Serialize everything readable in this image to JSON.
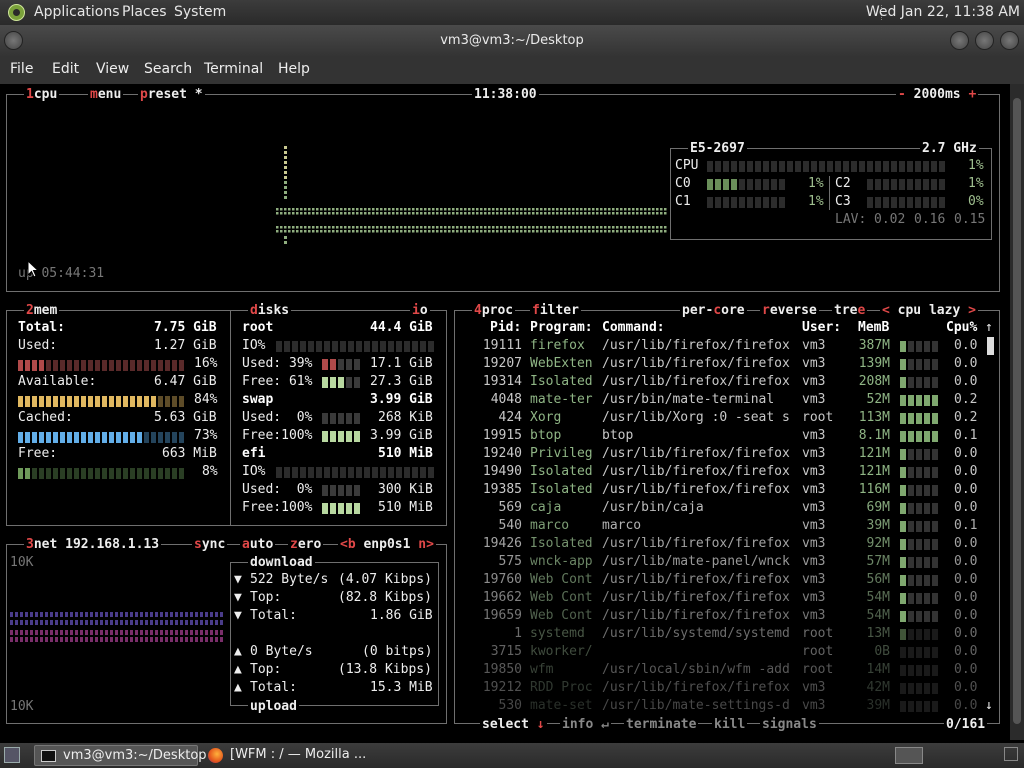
{
  "panel": {
    "menus": [
      "Applications",
      "Places",
      "System"
    ],
    "clock": "Wed Jan 22, 11:38 AM"
  },
  "window": {
    "title": "vm3@vm3:~/Desktop",
    "menus": [
      "File",
      "Edit",
      "View",
      "Search",
      "Terminal",
      "Help"
    ]
  },
  "cpu": {
    "tabs": {
      "n": "1",
      "cpu": "cpu",
      "menu": "menu",
      "preset": "preset",
      "star": "*"
    },
    "time": "11:38:00",
    "interval": "2000ms",
    "minus": "-",
    "plus": "+",
    "model": "E5-2697",
    "freq": "2.7 GHz",
    "total_label": "CPU",
    "total_pct": "1%",
    "cores": [
      {
        "label": "C0",
        "pct": "1%",
        "level": 0.01
      },
      {
        "label": "C2",
        "pct": "1%",
        "level": 0.01
      },
      {
        "label": "C1",
        "pct": "1%",
        "level": 0.01
      },
      {
        "label": "C3",
        "pct": "0%",
        "level": 0.0
      }
    ],
    "lav_label": "LAV:",
    "lav": [
      "0.02",
      "0.16",
      "0.15"
    ],
    "uptime": "up 05:44:31"
  },
  "mem": {
    "header": {
      "n": "2",
      "title": "mem"
    },
    "total_label": "Total:",
    "total": "7.75 GiB",
    "used_label": "Used:",
    "used": "1.27 GiB",
    "used_pct": "16%",
    "used_level": 0.16,
    "avail_label": "Available:",
    "avail": "6.47 GiB",
    "avail_pct": "84%",
    "avail_level": 0.84,
    "cached_label": "Cached:",
    "cached": "5.63 GiB",
    "cached_pct": "73%",
    "cached_level": 0.73,
    "free_label": "Free:",
    "free": "663 MiB",
    "free_pct": "8%",
    "free_level": 0.08
  },
  "disks": {
    "header": {
      "d": "d",
      "rest": "isks",
      "io_i": "i",
      "io_rest": "o"
    },
    "entries": [
      {
        "name": "root",
        "size": "44.4 GiB",
        "io": "IO%",
        "used_label": "Used: 39%",
        "used": "17.1 GiB",
        "free_label": "Free: 61%",
        "free": "27.3 GiB",
        "used_level": 0.39,
        "free_level": 0.61
      },
      {
        "name": "swap",
        "size": "3.99 GiB",
        "io": "",
        "used_label": "Used:  0%",
        "used": "268 KiB",
        "free_label": "Free:100%",
        "free": "3.99 GiB",
        "used_level": 0.0,
        "free_level": 1.0
      },
      {
        "name": "efi",
        "size": "510 MiB",
        "io": "IO%",
        "used_label": "Used:  0%",
        "used": "300 KiB",
        "free_label": "Free:100%",
        "free": "510 MiB",
        "used_level": 0.0,
        "free_level": 1.0
      }
    ]
  },
  "net": {
    "header": {
      "n": "3",
      "title": "net",
      "ip": "192.168.1.13",
      "sync": "sync",
      "auto_a": "a",
      "auto_rest": "uto",
      "zero_z": "z",
      "zero_rest": "ero",
      "lt": "<",
      "b": "b",
      "iface": "enp0s1",
      "gt": "n>"
    },
    "scale_top": "10K",
    "scale_bottom": "10K",
    "download_label": "download",
    "down_rate": "522 Byte/s",
    "down_rate_bits": "(4.07 Kibps)",
    "down_top_label": "Top:",
    "down_top": "(82.8 Kibps)",
    "down_total_label": "Total:",
    "down_total": "1.86 GiB",
    "up_rate": "0 Byte/s",
    "up_rate_bits": "(0 bitps)",
    "up_top_label": "Top:",
    "up_top": "(13.8 Kibps)",
    "up_total_label": "Total:",
    "up_total": "15.3 MiB",
    "upload_label": "upload"
  },
  "proc": {
    "header": {
      "n": "4",
      "title": "proc",
      "filter_f": "f",
      "filter_rest": "ilter",
      "percore_a": "per-",
      "percore_c": "c",
      "percore_b": "ore",
      "reverse_r": "r",
      "reverse_rest": "everse",
      "tree_a": "tre",
      "tree_e": "e",
      "lt": "<",
      "sort": "cpu lazy",
      "gt": ">"
    },
    "columns": {
      "pid": "Pid:",
      "program": "Program:",
      "command": "Command:",
      "user": "User:",
      "mem": "MemB",
      "cpu": "Cpu%"
    },
    "rows": [
      {
        "pid": "19111",
        "program": "firefox",
        "command": "/usr/lib/firefox/firefox",
        "user": "vm3",
        "mem": "387M",
        "cpu": "0.0",
        "spark": 0.2
      },
      {
        "pid": "19207",
        "program": "WebExten",
        "command": "/usr/lib/firefox/firefox",
        "user": "vm3",
        "mem": "139M",
        "cpu": "0.0",
        "spark": 0.15
      },
      {
        "pid": "19314",
        "program": "Isolated",
        "command": "/usr/lib/firefox/firefox",
        "user": "vm3",
        "mem": "208M",
        "cpu": "0.0",
        "spark": 0.15
      },
      {
        "pid": "4048",
        "program": "mate-ter",
        "command": "/usr/bin/mate-terminal",
        "user": "vm3",
        "mem": "52M",
        "cpu": "0.2",
        "spark": 0.9
      },
      {
        "pid": "424",
        "program": "Xorg",
        "command": "/usr/lib/Xorg :0 -seat s",
        "user": "root",
        "mem": "113M",
        "cpu": "0.2",
        "spark": 0.9
      },
      {
        "pid": "19915",
        "program": "btop",
        "command": "btop",
        "user": "vm3",
        "mem": "8.1M",
        "cpu": "0.1",
        "spark": 0.9
      },
      {
        "pid": "19240",
        "program": "Privileg",
        "command": "/usr/lib/firefox/firefox",
        "user": "vm3",
        "mem": "121M",
        "cpu": "0.0",
        "spark": 0.15
      },
      {
        "pid": "19490",
        "program": "Isolated",
        "command": "/usr/lib/firefox/firefox",
        "user": "vm3",
        "mem": "121M",
        "cpu": "0.0",
        "spark": 0.1
      },
      {
        "pid": "19385",
        "program": "Isolated",
        "command": "/usr/lib/firefox/firefox",
        "user": "vm3",
        "mem": "116M",
        "cpu": "0.0",
        "spark": 0.1
      },
      {
        "pid": "569",
        "program": "caja",
        "command": "/usr/bin/caja",
        "user": "vm3",
        "mem": "69M",
        "cpu": "0.0",
        "spark": 0.1
      },
      {
        "pid": "540",
        "program": "marco",
        "command": "marco",
        "user": "vm3",
        "mem": "39M",
        "cpu": "0.1",
        "spark": 0.1
      },
      {
        "pid": "19426",
        "program": "Isolated",
        "command": "/usr/lib/firefox/firefox",
        "user": "vm3",
        "mem": "92M",
        "cpu": "0.0",
        "spark": 0.1
      },
      {
        "pid": "575",
        "program": "wnck-app",
        "command": "/usr/lib/mate-panel/wnck",
        "user": "vm3",
        "mem": "57M",
        "cpu": "0.0",
        "spark": 0.1
      },
      {
        "pid": "19760",
        "program": "Web Cont",
        "command": "/usr/lib/firefox/firefox",
        "user": "vm3",
        "mem": "56M",
        "cpu": "0.0",
        "spark": 0.1
      },
      {
        "pid": "19662",
        "program": "Web Cont",
        "command": "/usr/lib/firefox/firefox",
        "user": "vm3",
        "mem": "54M",
        "cpu": "0.0",
        "spark": 0.1
      },
      {
        "pid": "19659",
        "program": "Web Cont",
        "command": "/usr/lib/firefox/firefox",
        "user": "vm3",
        "mem": "54M",
        "cpu": "0.0",
        "spark": 0.1
      },
      {
        "pid": "1",
        "program": "systemd",
        "command": "/usr/lib/systemd/systemd",
        "user": "root",
        "mem": "13M",
        "cpu": "0.0",
        "spark": 0.05
      },
      {
        "pid": "3715",
        "program": "kworker/",
        "command": "",
        "user": "root",
        "mem": "0B",
        "cpu": "0.0",
        "spark": 0.0
      },
      {
        "pid": "19850",
        "program": "wfm",
        "command": "/usr/local/sbin/wfm -add",
        "user": "root",
        "mem": "14M",
        "cpu": "0.0",
        "spark": 0.0
      },
      {
        "pid": "19212",
        "program": "RDD Proc",
        "command": "/usr/lib/firefox/firefox",
        "user": "vm3",
        "mem": "42M",
        "cpu": "0.0",
        "spark": 0.0
      },
      {
        "pid": "530",
        "program": "mate-set",
        "command": "/usr/lib/mate-settings-d",
        "user": "vm3",
        "mem": "39M",
        "cpu": "0.0",
        "spark": 0.0
      }
    ],
    "footer": {
      "select": "select",
      "arrow": "↓",
      "info_i": "i",
      "info_rest": "nfo",
      "enter": "↵",
      "terminate_t": "t",
      "terminate_rest": "erminate",
      "kill_k": "k",
      "kill_rest": "ill",
      "signals_s": "s",
      "signals_rest": "ignals",
      "count": "0/161"
    }
  },
  "taskbar": {
    "items": [
      "vm3@vm3:~/Desktop",
      "[WFM : / — Mozilla ..."
    ]
  }
}
